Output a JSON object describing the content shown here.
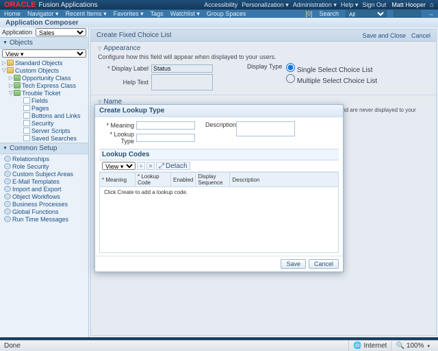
{
  "brand": {
    "vendor": "ORACLE",
    "product": "Fusion Applications"
  },
  "top_links": [
    "Accessibility",
    "Personalization ▾",
    "Administration ▾",
    "Help ▾",
    "Sign Out"
  ],
  "user": "Matt Hooper",
  "menu": {
    "items": [
      "Home",
      "Navigator ▾",
      "Recent Items ▾",
      "Favorites ▾",
      "Tags",
      "Watchlist ▾",
      "Group Spaces"
    ],
    "notif": "[0]",
    "search_label": "Search",
    "search_scope": "All",
    "search_value": ""
  },
  "composer": {
    "title": "Application Composer",
    "app_label": "Application",
    "app_value": "Sales"
  },
  "side": {
    "objects": "Objects",
    "view": "View ▾",
    "common": "Common Setup",
    "std": "Standard Objects",
    "cust": "Custom Objects",
    "opp": "Opportunity Class",
    "tex": "Tech Express Class",
    "tt": "Trouble Ticket",
    "fields": "Fields",
    "pages": "Pages",
    "btn": "Buttons and Links",
    "sec": "Security",
    "srv": "Server Scripts",
    "ss": "Saved Searches",
    "rel": "Relationships",
    "rls": "Role Security",
    "csa": "Custom Subject Areas",
    "eml": "E-Mail Templates",
    "imp": "Import and Export",
    "owf": "Object Workflows",
    "bp": "Business Processes",
    "gf": "Global Functions",
    "rtm": "Run Time Messages"
  },
  "pane": {
    "title": "Create Fixed Choice List",
    "save_close": "Save and Close",
    "cancel": "Cancel",
    "appearance": "Appearance",
    "app_hint": "Configure how this field will appear when displayed to your users.",
    "dlabel": "* Display Label",
    "dlabel_v": "Status",
    "help": "Help Text",
    "dtype": "Display Type",
    "r1": "Single Select Choice List",
    "r2": "Multiple Select Choice List",
    "name": "Name",
    "name_hint": "Each field requires a unique name in the system. Name and description are for internal use only, and are never displayed to your users."
  },
  "modal": {
    "title": "Create Lookup Type",
    "meaning": "* Meaning",
    "lkp": "* Lookup Type",
    "desc": "Description",
    "codes": "Lookup Codes",
    "view": "View ▾",
    "detach": "Detach",
    "cols": {
      "m": "* Meaning",
      "c": "* Lookup Code",
      "e": "Enabled",
      "ds": "Display Sequence",
      "d": "Description"
    },
    "empty": "Click Create to add a lookup code.",
    "save": "Save",
    "cancel": "Cancel"
  },
  "status": {
    "done": "Done",
    "net": "Internet",
    "zoom": "100%"
  }
}
